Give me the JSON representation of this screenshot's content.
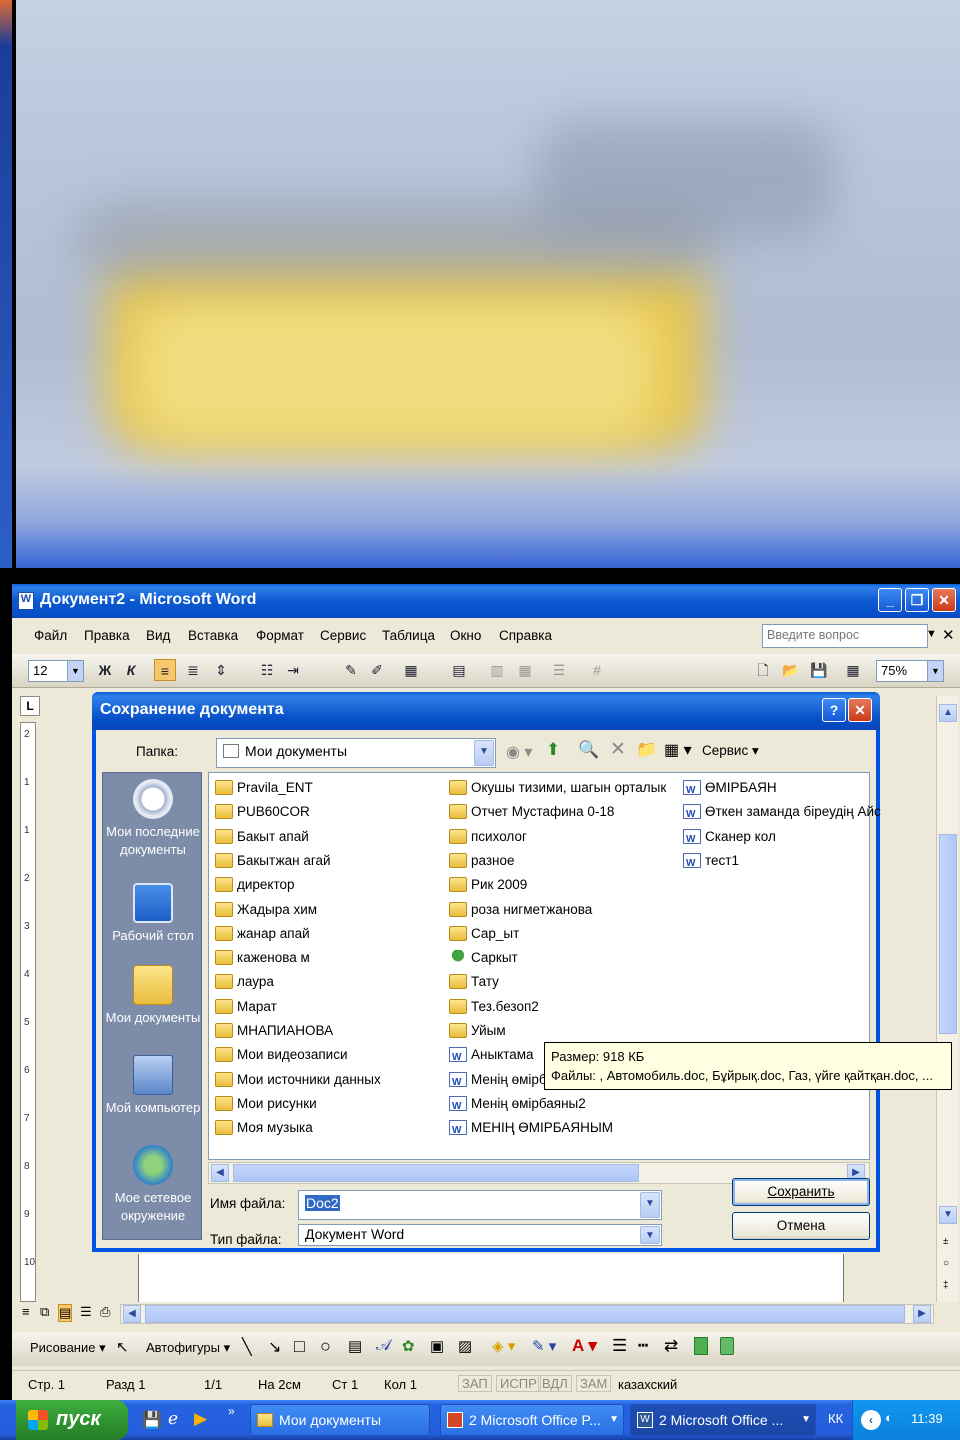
{
  "window": {
    "title": "Документ2 - Microsoft Word",
    "menu": [
      "Файл",
      "Правка",
      "Вид",
      "Вставка",
      "Формат",
      "Сервис",
      "Таблица",
      "Окно",
      "Справка"
    ],
    "ask_placeholder": "Введите вопрос",
    "font_size": "12",
    "zoom": "75%",
    "bold_glyph": "Ж",
    "italic_glyph": "К"
  },
  "dialog": {
    "title": "Сохранение документа",
    "folder_label": "Папка:",
    "folder_value": "Мои документы",
    "tools_label": "Сервис",
    "places": [
      "Мои последние документы",
      "Рабочий стол",
      "Мои документы",
      "Мой компьютер",
      "Мое сетевое окружение"
    ],
    "files_col1": [
      "Pravila_ENT",
      "PUB60COR",
      "Бакыт апай",
      "Бакытжан агай",
      "директор",
      "Жадыра хим",
      "жанар апай",
      "каженова м",
      "лаура",
      "Марат",
      "МНАПИАНОВА",
      "Мои видеозаписи",
      "Мои источники данных",
      "Мои рисунки",
      "Моя музыка"
    ],
    "files_col2": [
      "Окушы тизими, шагын орталык",
      "Отчет Мустафина 0-18",
      "психолог",
      "разное",
      "Рик 2009",
      "роза нигметжанова",
      "Сар_ыт",
      "Саркыт",
      "Тату",
      "Тез.безоп2",
      "Уйым",
      "Аныктама",
      "Менің өмірбая",
      "Менің өмірбаяны2",
      "МЕНІҢ ӨМІРБАЯНЫМ"
    ],
    "files_col3": [
      "ӨМІРБАЯН",
      "Өткен заманда біреудің Айс",
      "Сканер кол",
      "тест1"
    ],
    "tooltip_size": "Размер: 918 КБ",
    "tooltip_files": "Файлы: , Автомобиль.doc, Бұйрық.doc, Газ, үйге қайтқан.doc, ...",
    "filename_label": "Имя файла:",
    "filename_value": "Doc2",
    "filetype_label": "Тип файла:",
    "filetype_value": "Документ Word",
    "save_button": "Сохранить",
    "cancel_button": "Отмена"
  },
  "drawing_toolbar": {
    "draw_label": "Рисование",
    "autoshapes_label": "Автофигуры"
  },
  "statusbar": {
    "page": "Стр. 1",
    "section": "Разд 1",
    "pages": "1/1",
    "at": "На 2см",
    "line": "Ст 1",
    "col": "Кол 1",
    "flags": [
      "ЗАП",
      "ИСПР",
      "ВДЛ",
      "ЗАМ"
    ],
    "language": "казахский"
  },
  "taskbar": {
    "start": "пуск",
    "tasks": [
      "Мои документы",
      "2 Microsoft Office P...",
      "2 Microsoft Office ..."
    ],
    "lang": "КК",
    "time": "11:39"
  },
  "colors": {
    "xp_blue": "#0054e3",
    "xp_green": "#3fb040",
    "dialog_face": "#ece9d8"
  }
}
